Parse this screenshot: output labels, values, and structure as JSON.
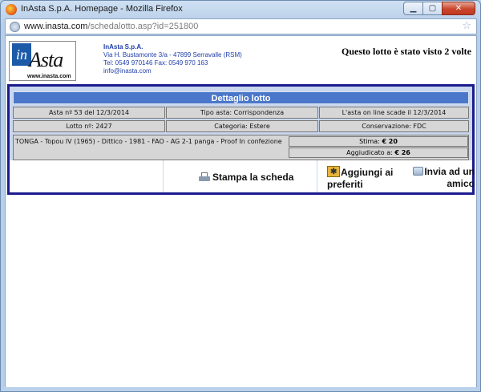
{
  "window": {
    "title": "InAsta S.p.A. Homepage - Mozilla Firefox",
    "url_domain": "www.inasta.com",
    "url_path": "/schedalotto.asp?id=251800"
  },
  "header": {
    "logo_in": "in",
    "logo_asta": "Asta",
    "logo_domain": "www.inasta.com",
    "company_name": "InAsta S.p.A.",
    "address": "Via H. Bustamonte 3/a - 47899 Serravalle (RSM)",
    "phone": "Tel: 0549 970146 Fax: 0549 970 163",
    "email": "info@inasta.com",
    "views_text": "Questo lotto è stato visto 2 volte"
  },
  "detail": {
    "title": "Dettaglio lotto",
    "row1": [
      "Asta nº 53 del 12/3/2014",
      "Tipo asta: Corrispondenza",
      "L'asta on line scade il 12/3/2014"
    ],
    "row2": [
      "Lotto nº: 2427",
      "Categoria: Estere",
      "Conservazione: FDC"
    ],
    "description": "TONGA - Topou IV (1965) - Dittico - 1981 - FAO - AG 2-1 panga - Proof In confezione",
    "stima_label": "Stima:",
    "stima_value": "€ 20",
    "aggiudicato_label": "Aggiudicato a:",
    "aggiudicato_value": "€ 26"
  },
  "actions": {
    "print_label": "Stampa la scheda",
    "favorites_label": "Aggiungi ai preferiti",
    "send_label": "Invia ad un amico"
  }
}
